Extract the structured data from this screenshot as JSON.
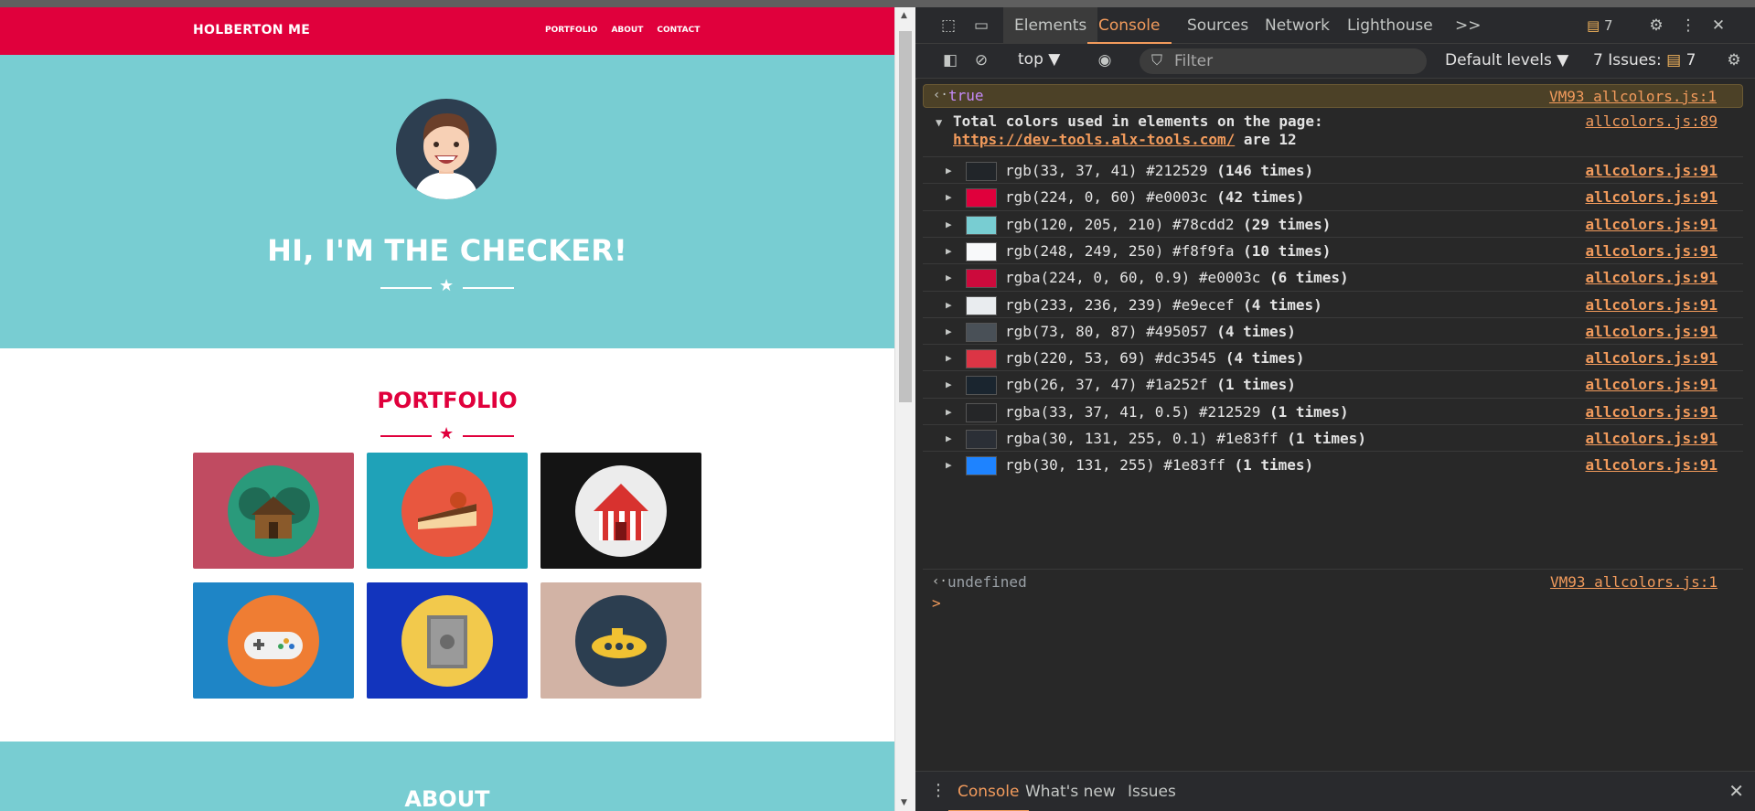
{
  "site": {
    "brand": "HOLBERTON ME",
    "nav": [
      "PORTFOLIO",
      "ABOUT",
      "CONTACT"
    ],
    "hero_title": "HI, I'M THE CHECKER!",
    "portfolio_title": "PORTFOLIO",
    "about_title": "ABOUT",
    "colors": {
      "primary": "#e0003c",
      "teal": "#78cdd2",
      "dark": "#2d3e50"
    },
    "tiles": [
      {
        "name": "cabin",
        "bg": "#c04b61",
        "disc": "#2a9a7b"
      },
      {
        "name": "cake",
        "bg": "#1fa2b8",
        "disc": "#e8573f"
      },
      {
        "name": "circus-tent",
        "bg": "#141414",
        "disc": "#ececec"
      },
      {
        "name": "game-controller",
        "bg": "#1e85c6",
        "disc": "#ef7d33"
      },
      {
        "name": "safe",
        "bg": "#1234bd",
        "disc": "#f2c94c"
      },
      {
        "name": "submarine",
        "bg": "#d2b3a5",
        "disc": "#2c3e50"
      }
    ]
  },
  "devtools": {
    "tabs": [
      "Elements",
      "Console",
      "Sources",
      "Network",
      "Lighthouse"
    ],
    "more_tabs": ">>",
    "issues_badge": "7",
    "context": "top ▼",
    "filter_placeholder": "Filter",
    "levels": "Default levels ▼",
    "issues_label": "7 Issues:",
    "issues_count": "7",
    "console": {
      "result_true": "true",
      "result_true_src": "VM93 allcolors.js:1",
      "header_line1": "Total colors used in elements on the page:",
      "header_link": "https://dev-tools.alx-tools.com/",
      "header_suffix": " are 12",
      "header_src": "allcolors.js:89",
      "rows": [
        {
          "swatch": "#212529",
          "text": "rgb(33, 37, 41) #212529 ",
          "count": "(146 times)",
          "src": "allcolors.js:91"
        },
        {
          "swatch": "#e0003c",
          "text": "rgb(224, 0, 60) #e0003c ",
          "count": "(42 times)",
          "src": "allcolors.js:91"
        },
        {
          "swatch": "#78cdd2",
          "text": "rgb(120, 205, 210) #78cdd2 ",
          "count": "(29 times)",
          "src": "allcolors.js:91"
        },
        {
          "swatch": "#f8f9fa",
          "text": "rgb(248, 249, 250) #f8f9fa ",
          "count": "(10 times)",
          "src": "allcolors.js:91"
        },
        {
          "swatch": "#cc0a3c",
          "text": "rgba(224, 0, 60, 0.9) #e0003c ",
          "count": "(6 times)",
          "src": "allcolors.js:91"
        },
        {
          "swatch": "#e9ecef",
          "text": "rgb(233, 236, 239) #e9ecef ",
          "count": "(4 times)",
          "src": "allcolors.js:91"
        },
        {
          "swatch": "#495057",
          "text": "rgb(73, 80, 87) #495057 ",
          "count": "(4 times)",
          "src": "allcolors.js:91"
        },
        {
          "swatch": "#dc3545",
          "text": "rgb(220, 53, 69) #dc3545 ",
          "count": "(4 times)",
          "src": "allcolors.js:91"
        },
        {
          "swatch": "#1a252f",
          "text": "rgb(26, 37, 47) #1a252f ",
          "count": "(1 times)",
          "src": "allcolors.js:91"
        },
        {
          "swatch": "#252628",
          "text": "rgba(33, 37, 41, 0.5) #212529 ",
          "count": "(1 times)",
          "src": "allcolors.js:91"
        },
        {
          "swatch": "#2b2f36",
          "text": "rgba(30, 131, 255, 0.1) #1e83ff ",
          "count": "(1 times)",
          "src": "allcolors.js:91"
        },
        {
          "swatch": "#1e83ff",
          "text": "rgb(30, 131, 255) #1e83ff ",
          "count": "(1 times)",
          "src": "allcolors.js:91"
        }
      ],
      "result_undefined": "undefined",
      "result_undefined_src": "VM93 allcolors.js:1",
      "prompt": ">"
    },
    "drawer_tabs": [
      "Console",
      "What's new",
      "Issues"
    ]
  }
}
